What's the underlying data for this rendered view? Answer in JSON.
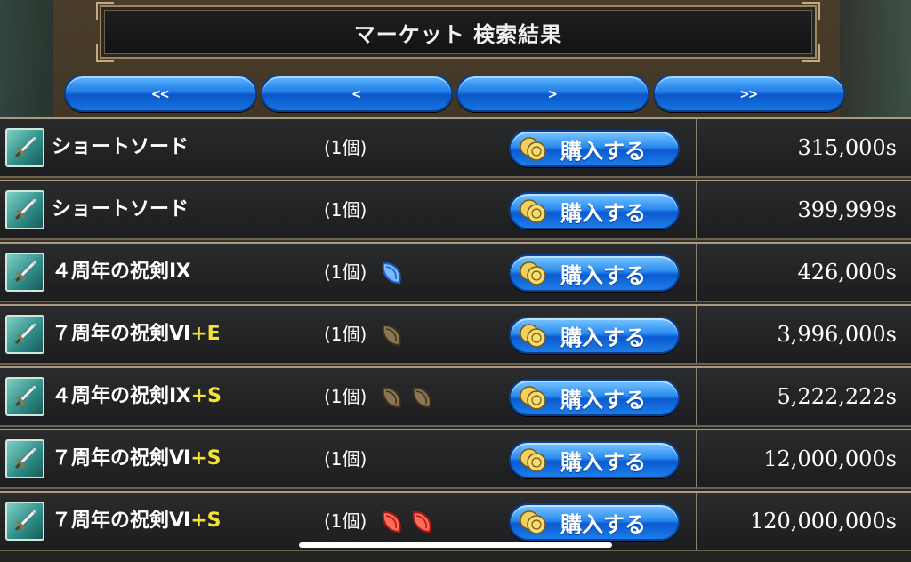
{
  "header": {
    "title": "マーケット 検索結果"
  },
  "nav": {
    "first": "<<",
    "prev": "<",
    "next": ">",
    "last": ">>"
  },
  "buy_label": "購入する",
  "colors": {
    "button_blue": "#1f7de6",
    "suffix_yellow": "#f2e23a",
    "gem_blue": "#3a86e8",
    "gem_brown": "#6a5a3e",
    "gem_red": "#d8342a"
  },
  "items": [
    {
      "name": "ショートソード",
      "suffix": "",
      "qty": "(1個)",
      "gems": [],
      "price": "315,000s"
    },
    {
      "name": "ショートソード",
      "suffix": "",
      "qty": "(1個)",
      "gems": [],
      "price": "399,999s"
    },
    {
      "name": "４周年の祝剣Ⅸ",
      "suffix": "",
      "qty": "(1個)",
      "gems": [
        "blue"
      ],
      "price": "426,000s"
    },
    {
      "name": "７周年の祝剣Ⅵ",
      "suffix": "+E",
      "qty": "(1個)",
      "gems": [
        "brown"
      ],
      "price": "3,996,000s"
    },
    {
      "name": "４周年の祝剣Ⅸ",
      "suffix": "+S",
      "qty": "(1個)",
      "gems": [
        "brown",
        "brown"
      ],
      "price": "5,222,222s"
    },
    {
      "name": "７周年の祝剣Ⅵ",
      "suffix": "+S",
      "qty": "(1個)",
      "gems": [],
      "price": "12,000,000s"
    },
    {
      "name": "７周年の祝剣Ⅵ",
      "suffix": "+S",
      "qty": "(1個)",
      "gems": [
        "red",
        "red"
      ],
      "price": "120,000,000s"
    }
  ]
}
